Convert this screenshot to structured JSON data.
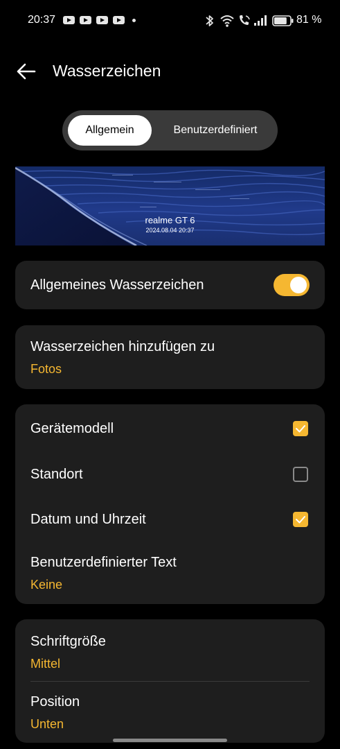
{
  "status_bar": {
    "time": "20:37",
    "notification_icons": [
      "youtube-icon",
      "youtube-icon",
      "youtube-icon",
      "youtube-icon"
    ],
    "system_icons": [
      "bluetooth-icon",
      "wifi-icon",
      "wifi-call-icon",
      "signal-icon",
      "battery-icon"
    ],
    "battery_text": "81 %",
    "battery_level": 0.81
  },
  "header": {
    "back_icon": "arrow-left-icon",
    "title": "Wasserzeichen"
  },
  "tabs": [
    {
      "label": "Allgemein",
      "active": true
    },
    {
      "label": "Benutzerdefiniert",
      "active": false
    }
  ],
  "preview": {
    "model": "realme GT 6",
    "datetime": "2024.08.04 20:37"
  },
  "general_watermark": {
    "label": "Allgemeines Wasserzeichen",
    "enabled": true
  },
  "add_to": {
    "label": "Wasserzeichen hinzufügen zu",
    "value": "Fotos"
  },
  "options": {
    "device_model": {
      "label": "Gerätemodell",
      "checked": true
    },
    "location": {
      "label": "Standort",
      "checked": false
    },
    "date_time": {
      "label": "Datum und Uhrzeit",
      "checked": true
    },
    "custom_text": {
      "label": "Benutzerdefinierter Text",
      "value": "Keine"
    }
  },
  "style": {
    "font_size": {
      "label": "Schriftgröße",
      "value": "Mittel"
    },
    "position": {
      "label": "Position",
      "value": "Unten"
    }
  },
  "colors": {
    "accent": "#f5b731",
    "background": "#000000",
    "card": "#1e1e1e"
  }
}
